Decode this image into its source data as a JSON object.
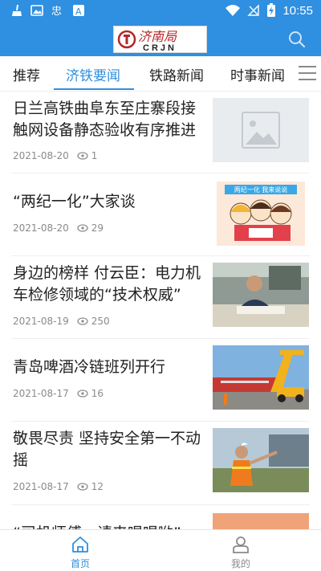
{
  "status_bar": {
    "time": "10:55"
  },
  "app": {
    "logo_text": "济南局",
    "logo_sub": "CRJN",
    "search_icon": "search-icon"
  },
  "tabs": [
    {
      "label": "推荐",
      "active": false
    },
    {
      "label": "济铁要闻",
      "active": true
    },
    {
      "label": "铁路新闻",
      "active": false
    },
    {
      "label": "时事新闻",
      "active": false
    }
  ],
  "articles": [
    {
      "title": "日兰高铁曲阜东至庄寨段接触网设备静态验收有序推进",
      "date": "2021-08-20",
      "views": "1",
      "thumb": "placeholder-image"
    },
    {
      "title": "“两纪一化”大家谈",
      "date": "2021-08-20",
      "views": "29",
      "thumb": "cartoon-illustration",
      "thumb_banner": "两纪一化 我来说说"
    },
    {
      "title": "身边的榜样 付云臣：电力机车检修领域的“技术权威”",
      "date": "2021-08-19",
      "views": "250",
      "thumb": "man-at-desk-photo"
    },
    {
      "title": "青岛啤酒冷链班列开行",
      "date": "2021-08-17",
      "views": "16",
      "thumb": "container-crane-photo"
    },
    {
      "title": "敬畏尽责 坚持安全第一不动摇",
      "date": "2021-08-17",
      "views": "12",
      "thumb": "railway-worker-photo"
    },
    {
      "title": "“司机师傅，请来喝喝哟”",
      "date": "",
      "views": "",
      "thumb": "partial-photo"
    }
  ],
  "bottom_nav": {
    "home_label": "首页",
    "me_label": "我的"
  },
  "colors": {
    "accent": "#2f8fe0",
    "text": "#222222",
    "meta": "#8a8a8a"
  }
}
